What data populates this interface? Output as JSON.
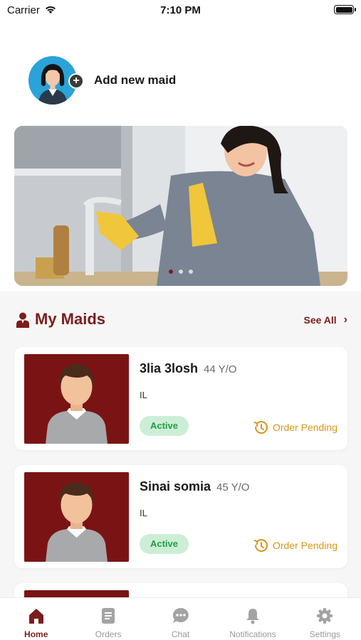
{
  "status_bar": {
    "carrier": "Carrier",
    "time": "7:10 PM"
  },
  "add_maid": {
    "label": "Add new maid",
    "plus_symbol": "+"
  },
  "banner": {
    "slide_count": 3,
    "active_slide": 0
  },
  "section": {
    "title": "My Maids",
    "see_all": "See All",
    "chevron": "›"
  },
  "maids": [
    {
      "name": "3lia 3losh",
      "age": "44 Y/O",
      "location": "IL",
      "status": "Active",
      "order_status": "Order Pending"
    },
    {
      "name": "Sinai somia",
      "age": "45 Y/O",
      "location": "IL",
      "status": "Active",
      "order_status": "Order Pending"
    }
  ],
  "nav": [
    {
      "label": "Home",
      "icon": "home-icon",
      "active": true
    },
    {
      "label": "Orders",
      "icon": "orders-icon",
      "active": false
    },
    {
      "label": "Chat",
      "icon": "chat-icon",
      "active": false
    },
    {
      "label": "Notifications",
      "icon": "bell-icon",
      "active": false
    },
    {
      "label": "Settings",
      "icon": "gear-icon",
      "active": false
    }
  ],
  "colors": {
    "brand": "#7a1d1d",
    "active_badge_bg": "#cdeed6",
    "active_badge_text": "#1e9e47",
    "pending": "#d8961a",
    "avatar_bg": "#2aa3d8"
  }
}
